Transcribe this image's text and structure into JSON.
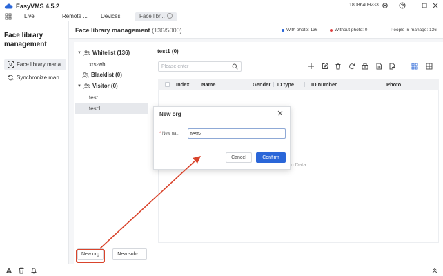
{
  "app": {
    "title": "EasyVMS 4.5.2",
    "phone": "18086409233"
  },
  "tabs": [
    {
      "label": "Live"
    },
    {
      "label": "Remote ..."
    },
    {
      "label": "Devices"
    },
    {
      "label": "Face libr..."
    }
  ],
  "sidebar": {
    "title": "Face library management",
    "items": [
      {
        "label": "Face library mana...",
        "icon": "face-scan-icon"
      },
      {
        "label": "Synchronize man...",
        "icon": "sync-icon"
      }
    ]
  },
  "header": {
    "title": "Face library management",
    "count": "(136/5000)",
    "with_photo": "With photo: 136",
    "without_photo": "Without photo: 0",
    "people_in_manage": "People in manage: 136",
    "with_photo_color": "#2a66d8",
    "without_photo_color": "#e04040"
  },
  "tree": {
    "whitelist": "Whitelist (136)",
    "whitelist_child": "xrs-wh",
    "blacklist": "Blacklist (0)",
    "visitor": "Visitor (0)",
    "visitor_children": [
      "test",
      "test1"
    ],
    "new_org_button": "New org",
    "new_sub_button": "New sub-..."
  },
  "content": {
    "group_title": "test1 (0)",
    "search_placeholder": "Please enter",
    "columns": [
      "Index",
      "Name",
      "Gender",
      "ID type",
      "ID number",
      "Photo"
    ],
    "no_data": "No Data"
  },
  "dialog": {
    "title": "New org",
    "label": "New na...",
    "value": "test2",
    "cancel": "Cancel",
    "confirm": "Confirm"
  },
  "accent_color": "#2a66d8",
  "highlight_color": "#d9442c"
}
